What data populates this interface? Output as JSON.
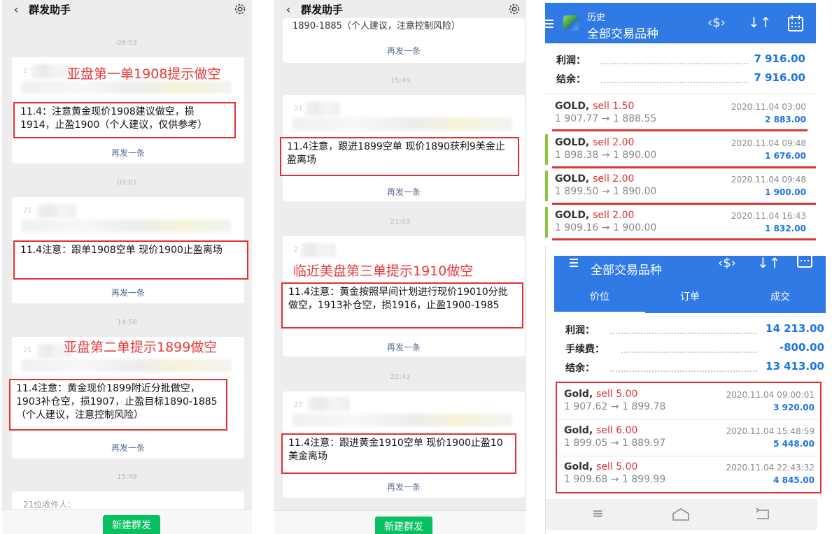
{
  "left_panel": {
    "header": {
      "back": "‹",
      "title": "群发助手"
    },
    "times": [
      "08:53",
      "09:01",
      "14:58",
      "15:49"
    ],
    "cards": [
      {
        "recipient_no": "2",
        "note": "亚盘第一单1908提示做空",
        "message": "11.4：注意黄金现价1908建议做空，损1914，止盈1900（个人建议，仅供参考）",
        "resend": "再发一条"
      },
      {
        "recipient_no": "21",
        "note": "",
        "message": "11.4注意：跟单1908空单 现价1900止盈离场",
        "resend": "再发一条"
      },
      {
        "recipient_no": "21",
        "note": "亚盘第二单提示1899做空",
        "message": "11.4注意：黄金现价1899附近分批做空，1903补仓空，损1907，止盈目标1890-1885（个人建议，注意控制风险）",
        "resend": "再发一条"
      }
    ],
    "last_recipients": "21位收件人：",
    "new_broadcast": "新建群发"
  },
  "middle_panel": {
    "header": {
      "back": "‹",
      "title": "群发助手"
    },
    "top_text": "1890-1885（个人建议，注意控制风险）",
    "top_resend": "再发一条",
    "times": [
      "15:49",
      "21:03",
      "22:43"
    ],
    "cards": [
      {
        "recipient_no": "21",
        "note": "",
        "message": "11.4注意，跟进1899空单 现价1890获利9美金止盈离场",
        "resend": "再发一条"
      },
      {
        "recipient_no": "2",
        "note": "临近美盘第三单提示1910做空",
        "message": "11.4注意：黄金按照早间计划进行现价19010分批做空，1913补仓空，损1916，止盈1900-1985",
        "resend": "再发一条"
      },
      {
        "recipient_no": "27",
        "note": "",
        "message": "11.4注意：跟进黄金1910空单 现价1900止盈10美金离场",
        "resend": "再发一条"
      }
    ],
    "new_broadcast": "新建群发"
  },
  "mt_top": {
    "header": {
      "subtitle": "历史",
      "title": "全部交易品种"
    },
    "summary": [
      {
        "label": "利润：",
        "value": "7 916.00"
      },
      {
        "label": "结余：",
        "value": "7 916.00"
      }
    ],
    "trades": [
      {
        "symbol": "GOLD,",
        "side": "sell 1.50",
        "prices": "1 907.77 → 1 888.55",
        "date": "2020.11.04 03:00",
        "profit": "2 883.00"
      },
      {
        "symbol": "GOLD,",
        "side": "sell 2.00",
        "prices": "1 898.38 → 1 890.00",
        "date": "2020.11.04 09:48",
        "profit": "1 676.00"
      },
      {
        "symbol": "GOLD,",
        "side": "sell 2.00",
        "prices": "1 899.50 → 1 890.00",
        "date": "2020.11.04 09:48",
        "profit": "1 900.00"
      },
      {
        "symbol": "GOLD,",
        "side": "sell 2.00",
        "prices": "1 909.16 → 1 900.00",
        "date": "2020.11.04 16:43",
        "profit": "1 832.00"
      }
    ]
  },
  "mt_bottom": {
    "header": {
      "title": "全部交易品种"
    },
    "tabs": [
      "价位",
      "订单",
      "成交"
    ],
    "summary": [
      {
        "label": "利润：",
        "value": "14 213.00"
      },
      {
        "label": "手续费：",
        "value": "-800.00"
      },
      {
        "label": "结余：",
        "value": "13 413.00"
      }
    ],
    "trades": [
      {
        "symbol": "Gold,",
        "side": "sell 5.00",
        "prices": "1 907.62 → 1 899.78",
        "date": "2020.11.04 09:00:01",
        "profit": "3 920.00"
      },
      {
        "symbol": "Gold,",
        "side": "sell 6.00",
        "prices": "1 899.05 → 1 889.97",
        "date": "2020.11.04 15:48:59",
        "profit": "5 448.00"
      },
      {
        "symbol": "Gold,",
        "side": "sell 5.00",
        "prices": "1 909.68 → 1 899.99",
        "date": "2020.11.04 22:43:32",
        "profit": "4 845.00"
      }
    ],
    "nav_icons": [
      "menu-icon",
      "home-icon",
      "back-icon"
    ]
  },
  "colors": {
    "accent_blue": "#2f7ae5",
    "highlight_red": "#e03232",
    "profit_blue": "#1a73e8",
    "sell_red": "#d33333",
    "wechat_green": "#07c160"
  }
}
